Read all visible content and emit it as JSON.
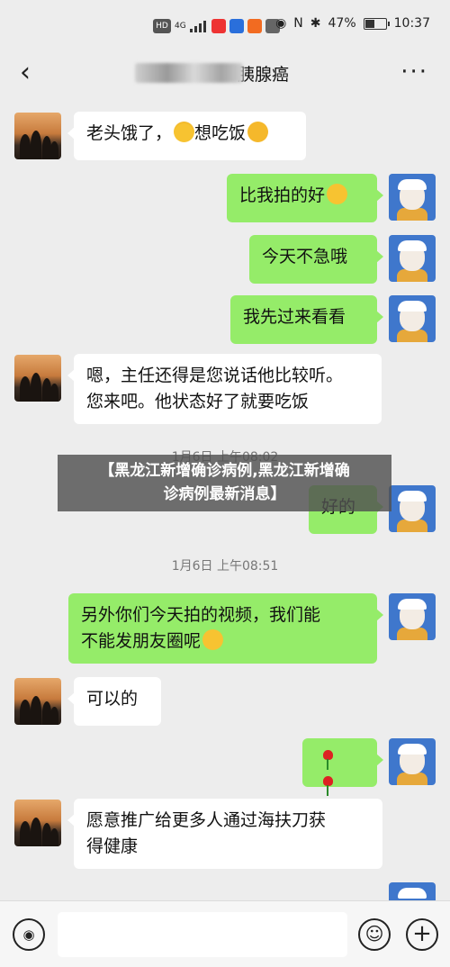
{
  "status_bar": {
    "network": "4G",
    "hd": "HD",
    "battery": "47%",
    "battery_level": 0.47,
    "time": "10:37"
  },
  "header": {
    "back_icon": "‹",
    "title_visible": "胰腺癌",
    "more_icon": "···"
  },
  "messages": [
    {
      "side": "left",
      "text": "老头饿了，",
      "text2": "想吃饭"
    },
    {
      "side": "right",
      "text": "比我拍的好"
    },
    {
      "side": "right",
      "text": "今天不急哦"
    },
    {
      "side": "right",
      "text": "我先过来看看"
    },
    {
      "side": "left",
      "line1": "嗯，主任还得是您说话他比较听。",
      "line2": "您来吧。他状态好了就要吃饭"
    },
    {
      "side": "right",
      "text": "好的"
    },
    {
      "side": "right",
      "line1": "另外你们今天拍的视频，我们能",
      "line2": "不能发朋友圈呢"
    },
    {
      "side": "left",
      "text": "可以的"
    },
    {
      "side": "right",
      "icon": "rose-icon"
    },
    {
      "side": "left",
      "line1": "愿意推广给更多人通过海扶刀获",
      "line2": "得健康"
    }
  ],
  "timestamps": [
    "1月6日 上午08:02",
    "1月6日 上午08:51"
  ],
  "banner": {
    "line1": "【黑龙江新增确诊病例,黑龙江新增确",
    "line2": "诊病例最新消息】"
  },
  "input_bar": {
    "voice_icon": "◉",
    "emoji_icon": "☺",
    "plus_icon": "+"
  }
}
